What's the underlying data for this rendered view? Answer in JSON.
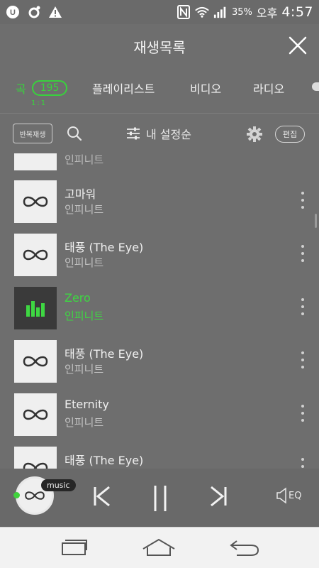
{
  "status_bar": {
    "battery_percent": "35",
    "battery_unit": "%",
    "ampm": "오후",
    "time": "4:57",
    "icons": [
      "u-plus-icon",
      "cloud-sync-icon",
      "warning-icon",
      "nfc-icon",
      "wifi-icon",
      "signal-icon",
      "battery-icon"
    ]
  },
  "header": {
    "title": "재생목록",
    "close_icon": "close-icon"
  },
  "tabs": {
    "song": "곡",
    "song_count": "195",
    "song_sub": "1:1",
    "playlist": "플레이리스트",
    "video": "비디오",
    "radio": "라디오"
  },
  "toolbar": {
    "repeat_label": "반복재생",
    "sort_label": "내 설정순",
    "edit_label": "편집"
  },
  "list": {
    "partial_artist": "인피니트",
    "items": [
      {
        "title": "고마워",
        "artist": "인피니트",
        "active": false
      },
      {
        "title": "태풍 (The Eye)",
        "artist": "인피니트",
        "active": false
      },
      {
        "title": "Zero",
        "artist": "인피니트",
        "active": true
      },
      {
        "title": "태풍 (The Eye)",
        "artist": "인피니트",
        "active": false
      },
      {
        "title": "Eternity",
        "artist": "인피니트",
        "active": false
      },
      {
        "title": "태풍 (The Eye)",
        "artist": "",
        "active": false
      }
    ]
  },
  "player": {
    "badge": "music",
    "eq_label": "EQ"
  }
}
